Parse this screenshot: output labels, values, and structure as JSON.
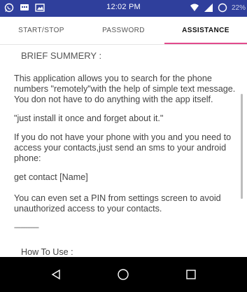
{
  "status_bar": {
    "time": "12:02 PM",
    "battery": "22%",
    "icons": [
      "whatsapp-icon",
      "message-icon",
      "image-icon",
      "wifi-icon",
      "signal-icon",
      "battery-icon"
    ]
  },
  "tabs": [
    {
      "label": "START/STOP"
    },
    {
      "label": "PASSWORD"
    },
    {
      "label": "ASSISTANCE"
    }
  ],
  "active_tab": "ASSISTANCE",
  "accent_color": "#e24a8d",
  "status_bar_color": "#2f3f9c",
  "content": {
    "heading": "BRIEF SUMMERY :",
    "para1": "This application allows you to search for the phone numbers \"remotely\"with the help of simple text message.",
    "para2": "You don not have to do anything with the app itself.",
    "quote": "\"just install it once and forget about it.\"",
    "para3": "If you do not have your phone with you and you need to access your contacts,just send an sms to your android phone:",
    "command": "get contact [Name]",
    "para4": "You can even set a PIN from settings screen to avoid unauthorized access to your contacts.",
    "divider": "---------------",
    "heading2": "How To Use :"
  },
  "nav": {
    "icons": [
      "back-icon",
      "home-icon",
      "recents-icon"
    ]
  }
}
